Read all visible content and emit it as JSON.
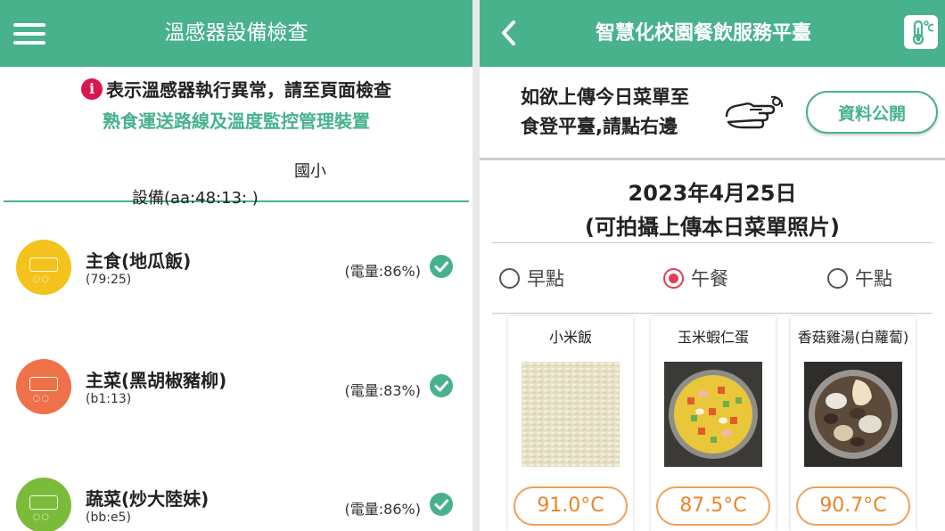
{
  "left": {
    "title": "溫感器設備檢查",
    "notice_line1": "表示溫感器執行異常，請至頁面檢查",
    "notice_line2": "熟食運送路線及溫度監控管理裝置",
    "school": "國小",
    "device": "設備(aa:48:13:            )",
    "sensors": [
      {
        "name": "主食(地瓜飯)",
        "mac": "(79:25)",
        "battery": "(電量:86%)",
        "color": "#f4c21c"
      },
      {
        "name": "主菜(黑胡椒豬柳)",
        "mac": "(b1:13)",
        "battery": "(電量:83%)",
        "color": "#ef7149"
      },
      {
        "name": "蔬菜(炒大陸妹)",
        "mac": "(bb:e5)",
        "battery": "(電量:86%)",
        "color": "#7bbb3a"
      }
    ]
  },
  "right": {
    "title": "智慧化校園餐飲服務平臺",
    "upload_line1": "如欲上傳今日菜單至",
    "upload_line2": "食登平臺,請點右邊",
    "public_button": "資料公開",
    "date": "2023年4月25日",
    "photo_hint": "(可拍攝上傳本日菜單照片)",
    "meals": [
      {
        "label": "早點",
        "selected": false
      },
      {
        "label": "午餐",
        "selected": true
      },
      {
        "label": "午點",
        "selected": false
      }
    ],
    "dishes": [
      {
        "name": "小米飯",
        "temp": "91.0°C"
      },
      {
        "name": "玉米蝦仁蛋",
        "temp": "87.5°C"
      },
      {
        "name": "香菇雞湯(白蘿蔔)",
        "temp": "90.7°C"
      }
    ]
  },
  "colors": {
    "primary": "#48b28c",
    "alert": "#d9164d",
    "radio_selected": "#e23e57",
    "temp": "#e8862c"
  }
}
